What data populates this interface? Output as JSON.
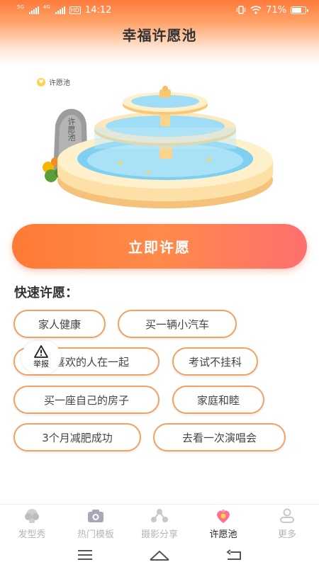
{
  "status_bar": {
    "net1": "5G",
    "net2": "4G",
    "hd": "HD",
    "time": "14:12",
    "battery_text": "71%",
    "battery_level": 0.71
  },
  "header": {
    "title": "幸福许愿池"
  },
  "hero": {
    "pool_tag": "许愿池",
    "stone_text": "许愿池"
  },
  "wish_button": {
    "label": "立即许愿"
  },
  "quick": {
    "title": "快速许愿：",
    "chips": [
      "家人健康",
      "买一辆小汽车",
      "和喜欢的人在一起",
      "考试不挂科",
      "买一座自己的房子",
      "家庭和睦",
      "3个月减肥成功",
      "去看一次演唱会"
    ]
  },
  "report": {
    "label": "举报"
  },
  "tabs": [
    {
      "label": "发型秀",
      "icon": "hairstyle-icon",
      "active": false
    },
    {
      "label": "热门模板",
      "icon": "camera-icon",
      "active": false
    },
    {
      "label": "摄影分享",
      "icon": "share-icon",
      "active": false
    },
    {
      "label": "许愿池",
      "icon": "wish-pool-icon",
      "active": true
    },
    {
      "label": "更多",
      "icon": "person-icon",
      "active": false
    }
  ],
  "colors": {
    "accent": "#ff7a35",
    "chip_border": "#f2a163"
  }
}
